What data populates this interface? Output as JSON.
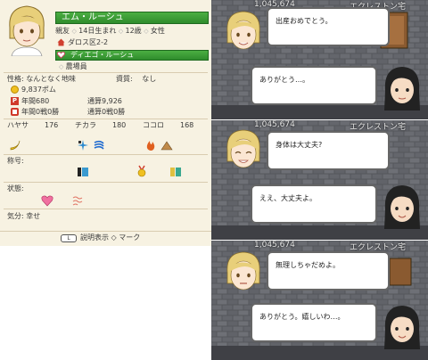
{
  "status": {
    "name": "エム・ルーシュ",
    "relation": "親友",
    "birth": "14日生まれ",
    "age": "12歳",
    "gender": "女性",
    "address": "ダロス区2-2",
    "partner": "ディエゴ・ルーシュ",
    "job": "農場員",
    "personality_label": "性格:",
    "personality": "なんとなく地味",
    "talent_label": "資質:",
    "talent": "なし",
    "money": "9,837ポム",
    "annual_label": "年間680",
    "total_label": "通算9,926",
    "annual_battle": "年間0戦0勝",
    "total_battle": "通算0戦0勝",
    "stats": [
      {
        "label": "ハヤサ",
        "value": "176"
      },
      {
        "label": "チカラ",
        "value": "180"
      },
      {
        "label": "ココロ",
        "value": "168"
      }
    ],
    "title_label": "称号:",
    "condition_label": "状態:",
    "mood_label": "気分:",
    "mood": "幸せ",
    "help_key": "L",
    "help_text": "説明表示",
    "mark_text": "マーク",
    "colors": {
      "green_bar": "#3c9e37",
      "panel_bg": "#f7f2e2"
    }
  },
  "scenes": [
    {
      "money": "1,045,674",
      "place": "エクレストン宅",
      "top_text": "出産おめでとう。",
      "bottom_text": "ありがとう…。"
    },
    {
      "money": "1,045,674",
      "place": "エクレストン宅",
      "top_text": "身体は大丈夫?",
      "bottom_text": "ええ、大丈夫よ。"
    },
    {
      "money": "1,045,674",
      "place": "エクレストン宅",
      "top_text": "無理しちゃだめよ。",
      "bottom_text": "ありがとう。嬉しいわ…。"
    }
  ]
}
